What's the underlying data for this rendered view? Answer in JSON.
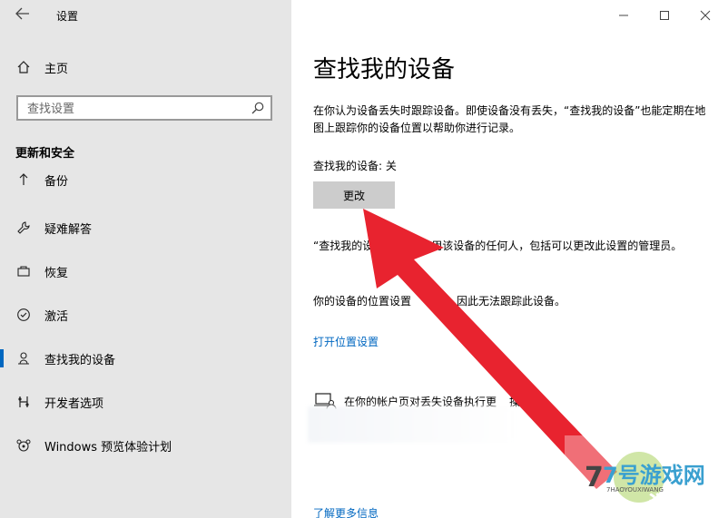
{
  "window": {
    "title": "设置",
    "controls": [
      "minimize",
      "maximize",
      "close"
    ]
  },
  "sidebar": {
    "home_label": "主页",
    "search_placeholder": "查找设置",
    "section_title": "更新和安全",
    "items": [
      {
        "label": "备份",
        "icon": "backup-icon"
      },
      {
        "label": "疑难解答",
        "icon": "wrench-icon"
      },
      {
        "label": "恢复",
        "icon": "recovery-icon"
      },
      {
        "label": "激活",
        "icon": "check-circle-icon"
      },
      {
        "label": "查找我的设备",
        "icon": "person-icon",
        "active": true
      },
      {
        "label": "开发者选项",
        "icon": "developer-icon"
      },
      {
        "label": "Windows 预览体验计划",
        "icon": "insider-icon"
      }
    ]
  },
  "main": {
    "title": "查找我的设备",
    "description": "在你认为设备丢失时跟踪设备。即使设备没有丢失，“查找我的设备”也能定期在地图上跟踪你的设备位置以帮助你进行记录。",
    "status_text": "查找我的设备: 关",
    "change_button": "更改",
    "impact_note_start": "“查找我的设",
    "impact_note_end": "响使用该设备的任何人，包括可以更改此设置的管理员。",
    "location_note_start": "你的设备的位置设置",
    "location_note_end": "闭，因此无法跟踪此设备。",
    "location_link": "打开位置设置",
    "related_text": "在你的帐户页对丢失设备执行更",
    "related_text_end": "操作",
    "learn_more": "了解更多信息"
  },
  "colors": {
    "sidebar_bg": "#e6e6e6",
    "accent": "#0067c0",
    "arrow": "#e8232f",
    "button_bg": "#cccccc"
  },
  "watermark": {
    "brand": "7号游戏网",
    "sub": "7HAOYOUXIWANG"
  }
}
